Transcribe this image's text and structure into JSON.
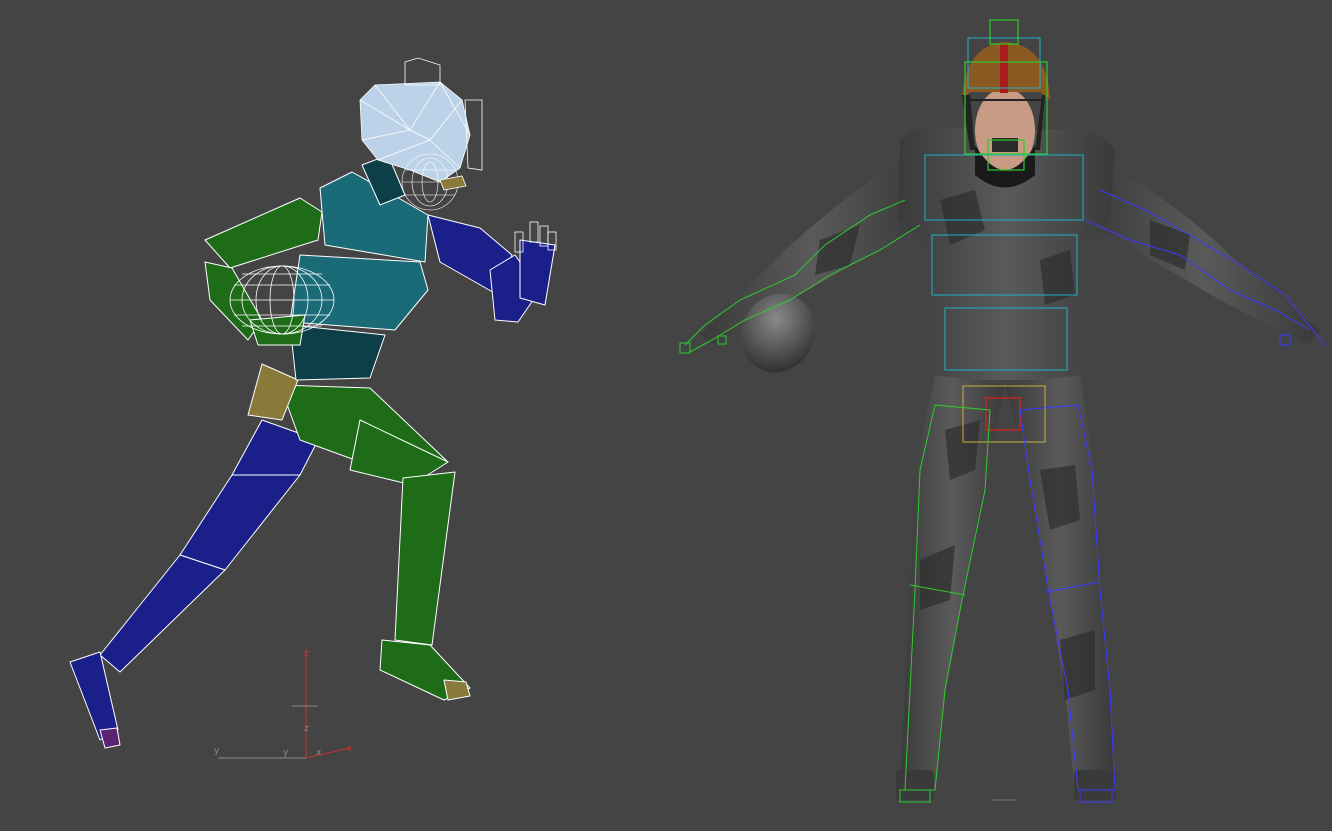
{
  "viewport": {
    "background": "#444444"
  },
  "axis_gizmo": {
    "labels": {
      "z_top": "z",
      "z_mid": "z",
      "y_left": "y",
      "y_mid": "y",
      "x_mid": "x",
      "x_right": "x"
    },
    "colors": {
      "z_axis": "#c83232",
      "x_axis": "#c83232",
      "y_axis": "#8a8a8a"
    }
  },
  "figures": {
    "left": {
      "kind": "biped-skeleton-running",
      "palette": {
        "left_limbs": "#1e6b18",
        "right_limbs": "#1a1f8a",
        "torso": "#1a6a78",
        "torso_dark": "#0d3f48",
        "pelvis": "#8a7a3a",
        "head_mesh": "#bcd2e8",
        "wire": "#ffffff"
      }
    },
    "right": {
      "kind": "textured-player-t-pose",
      "palette": {
        "uniform": "#3c3c3c",
        "uniform_light": "#5a5a5a",
        "helmet": "#8a5a22",
        "helmet_stripe": "#a81c1c",
        "skin": "#c89c84",
        "bone_left": "#2ecc2e",
        "bone_right": "#3a3aff",
        "bone_spine": "#1fb0c8",
        "bone_pelvis": "#cc2222",
        "bone_hip": "#c8b040",
        "ball": "#505050"
      }
    }
  }
}
